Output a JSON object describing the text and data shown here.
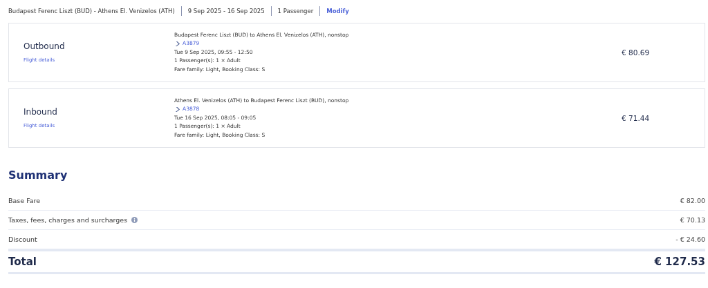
{
  "header": {
    "route": "Budapest Ferenc Liszt (BUD) - Athens El. Venizelos (ATH)",
    "dates": "9 Sep 2025 - 16 Sep 2025",
    "passengers": "1 Passenger",
    "modify": "Modify"
  },
  "flights": [
    {
      "direction": "Outbound",
      "details_link": "Flight details",
      "route": "Budapest Ferenc Liszt (BUD) to Athens El. Venizelos (ATH), nonstop",
      "flight_number": "A3879",
      "time": "Tue 9 Sep 2025, 09:55 - 12:50",
      "passengers": "1 Passenger(s): 1 × Adult",
      "fare": "Fare family: Light, Booking Class: S",
      "price": "€ 80.69"
    },
    {
      "direction": "Inbound",
      "details_link": "Flight details",
      "route": "Athens El. Venizelos (ATH) to Budapest Ferenc Liszt (BUD), nonstop",
      "flight_number": "A3878",
      "time": "Tue 16 Sep 2025, 08:05 - 09:05",
      "passengers": "1 Passenger(s): 1 × Adult",
      "fare": "Fare family: Light, Booking Class: S",
      "price": "€ 71.44"
    }
  ],
  "summary": {
    "title": "Summary",
    "rows": [
      {
        "label": "Base Fare",
        "amount": "€ 82.00",
        "info": false
      },
      {
        "label": "Taxes, fees, charges and surcharges",
        "amount": "€ 70.13",
        "info": true
      },
      {
        "label": "Discount",
        "amount": "- € 24.60",
        "info": false
      }
    ],
    "total": {
      "label": "Total",
      "amount": "€ 127.53"
    }
  }
}
